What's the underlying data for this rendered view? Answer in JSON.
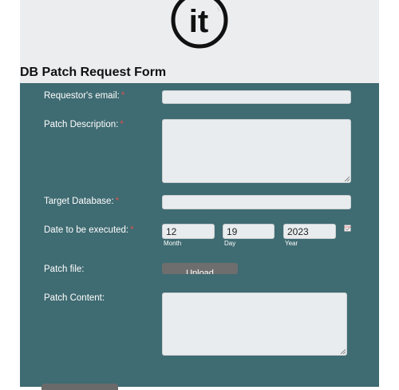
{
  "header": {
    "logo_text": "it",
    "title": "DB Patch Request Form"
  },
  "form": {
    "email": {
      "label": "Requestor's email:",
      "required": "*",
      "value": ""
    },
    "description": {
      "label": "Patch Description:",
      "required": "*",
      "value": ""
    },
    "database": {
      "label": "Target Database:",
      "required": "*",
      "value": ""
    },
    "date": {
      "label": "Date to be executed:",
      "required": "*",
      "month": {
        "value": "12",
        "caption": "Month"
      },
      "day": {
        "value": "19",
        "caption": "Day"
      },
      "year": {
        "value": "2023",
        "caption": "Year"
      }
    },
    "file": {
      "label": "Patch file:",
      "button_label": "Upload"
    },
    "content": {
      "label": "Patch Content:",
      "value": ""
    }
  },
  "colors": {
    "panel": "#3f6b72",
    "header_band": "#ecedef",
    "required": "#d9534f",
    "button": "#6e6e6e"
  }
}
